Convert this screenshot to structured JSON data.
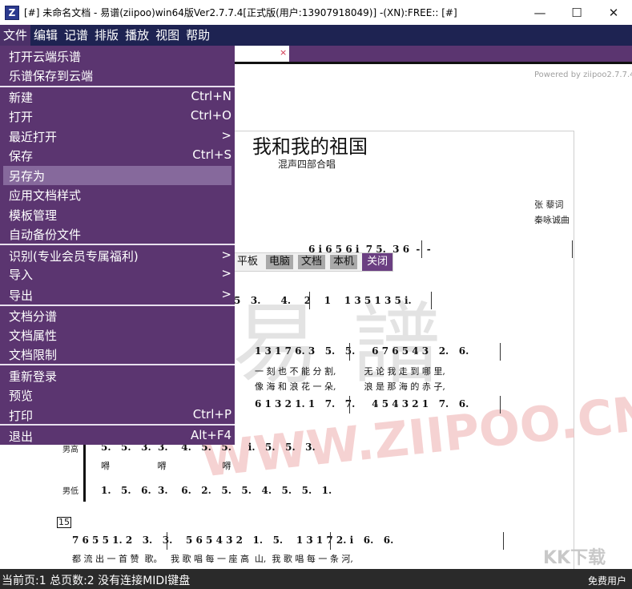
{
  "window": {
    "app_icon": "Z",
    "title": "[#] 未命名文档 - 易谱(ziipoo)win64版Ver2.7.7.4[正式版(用户:13907918049)] -(XN):FREE:: [#]",
    "minimize_glyph": "—",
    "maximize_glyph": "☐",
    "close_glyph": "✕"
  },
  "menubar": {
    "items": [
      "文件",
      "编辑",
      "记谱",
      "排版",
      "播放",
      "视图",
      "帮助"
    ]
  },
  "tab": {
    "close_glyph": "×"
  },
  "file_menu": {
    "items": [
      {
        "label": "打开云端乐谱",
        "shortcut": ""
      },
      {
        "label": "乐谱保存到云端",
        "shortcut": ""
      },
      {
        "label": "新建",
        "shortcut": "Ctrl+N"
      },
      {
        "label": "打开",
        "shortcut": "Ctrl+O"
      },
      {
        "label": "最近打开",
        "shortcut": ">"
      },
      {
        "label": "保存",
        "shortcut": "Ctrl+S"
      },
      {
        "label": "另存为",
        "shortcut": ""
      },
      {
        "label": "应用文档样式",
        "shortcut": ""
      },
      {
        "label": "模板管理",
        "shortcut": ""
      },
      {
        "label": "自动备份文件",
        "shortcut": ""
      },
      {
        "label": "识别(专业会员专属福利)",
        "shortcut": ">"
      },
      {
        "label": "导入",
        "shortcut": ">"
      },
      {
        "label": "导出",
        "shortcut": ">"
      },
      {
        "label": "文档分谱",
        "shortcut": ""
      },
      {
        "label": "文档属性",
        "shortcut": ""
      },
      {
        "label": "文档限制",
        "shortcut": ""
      },
      {
        "label": "重新登录",
        "shortcut": ""
      },
      {
        "label": "预览",
        "shortcut": ""
      },
      {
        "label": "打印",
        "shortcut": "Ctrl+P"
      },
      {
        "label": "退出",
        "shortcut": "Alt+F4"
      }
    ]
  },
  "view_toolbar": {
    "buttons": [
      "平板",
      "电脑",
      "文档",
      "本机",
      "关闭"
    ]
  },
  "document": {
    "powered_by": "Powered by ziipoo2.7.7.4",
    "title": "我和我的祖国",
    "subtitle": "混声四部合唱",
    "lyricist": "张  藜词",
    "composer": "秦咏诚曲",
    "watermark_cn": "易譜",
    "watermark_url": "WWW.ZIIPOO.CN",
    "watermark_site": "KK下载",
    "measure_number": "15",
    "parts": {
      "alto_high": "男高",
      "bass_low": "男低"
    },
    "score": {
      "row1_notes": "6 i 6 5 6 i  7 5.  3 6  -  -",
      "row2_notes": "5   3.      4.    2    1    1 3 5 1 3 5 i.",
      "row3_notes": "1 3 1 7 6. 3   5.   5.     6 7 6 5 4 3   2.   6.",
      "row3_lyric_a": "一 刻 也 不 能 分 割,          无 论 我 走 到 哪 里,",
      "row3_lyric_b": "像 海 和 浪 花 一 朵,          浪 是 那 海 的 赤 子,",
      "row4_notes": "6 1 3 2 1. 1   7.   7.     4 5 4 3 2 1   7.   6.",
      "row5_notes": "5.   5.   3.  3.    4.   5.   5.     i.   5.   5.   3.",
      "row5_lyric": "嘚                 嘚                    嘚",
      "row6_notes": "1.   5.   6.  3.    6.   2.   5.   5.   4.   5.   5.   1.",
      "row7_notes": "7 6 5 5 1. 2   3.   3.    5 6 5 4 3 2   1.   5.    1 3 1 7 2. i   6.   6.",
      "row7_lyric": "都 流 出 一 首 赞  歌。   我 歌 唱 每 一 座 高  山,  我 歌 唱 每 一 条 河,"
    }
  },
  "statusbar": {
    "text": "当前页:1 总页数:2 没有连接MIDI键盘",
    "user_type": "免费用户"
  },
  "colors": {
    "menubar_bg": "#1e2352",
    "menu_bg": "#5b3570",
    "menu_hover": "#86699c",
    "statusbar_bg": "#2a2a2a",
    "close_button_bg": "#6b3f82"
  }
}
